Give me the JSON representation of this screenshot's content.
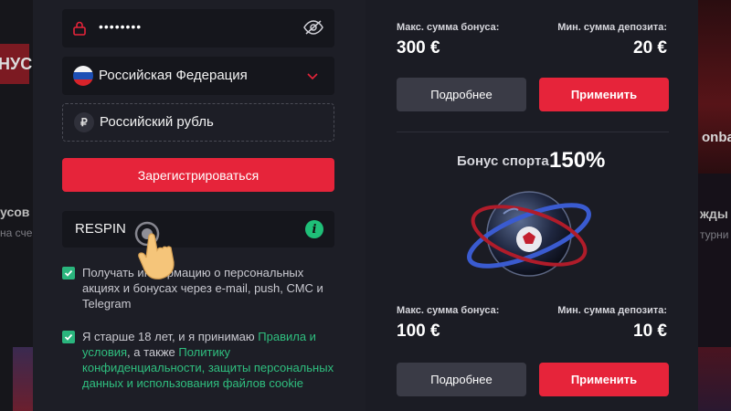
{
  "background": {
    "left_banner": "НУС",
    "left_heading": "усов",
    "left_sub": "на сче",
    "right_top": "onba",
    "right_heading": "жды",
    "right_sub": "турни"
  },
  "registration": {
    "password_dots": "••••••••",
    "country": "Российская Федерация",
    "currency": "Российский рубль",
    "currency_symbol": "₽",
    "register_button": "Зарегистрироваться",
    "promo_code": "RESPIN",
    "consent_news": "Получать информацию о персональных акциях и бонусах через e-mail, push, СМС и Telegram",
    "consent_age_prefix": "Я старше 18 лет, и я принимаю ",
    "consent_rules_link": "Правила и условия",
    "consent_age_mid": ", а также ",
    "consent_privacy_link": "Политику конфиденциальности, защиты персональных данных и использования файлов cookie"
  },
  "bonuses": [
    {
      "max_label": "Макс. сумма бонуса:",
      "max_value": "300 €",
      "min_label": "Мин. сумма депозита:",
      "min_value": "20 €",
      "more_button": "Подробнее",
      "apply_button": "Применить"
    },
    {
      "title": "Бонус спорта",
      "percent": "150%",
      "max_label": "Макс. сумма бонуса:",
      "max_value": "100 €",
      "min_label": "Мин. сумма депозита:",
      "min_value": "10 €",
      "more_button": "Подробнее",
      "apply_button": "Применить"
    }
  ],
  "colors": {
    "accent_red": "#e6243a",
    "link_green": "#2fbf7f",
    "panel_bg": "#1d1e26"
  },
  "icons": [
    "lock-icon",
    "eye-slash-icon",
    "russia-flag-icon",
    "chevron-down-icon",
    "ruble-icon",
    "info-icon",
    "check-icon",
    "hand-pointer-icon"
  ]
}
